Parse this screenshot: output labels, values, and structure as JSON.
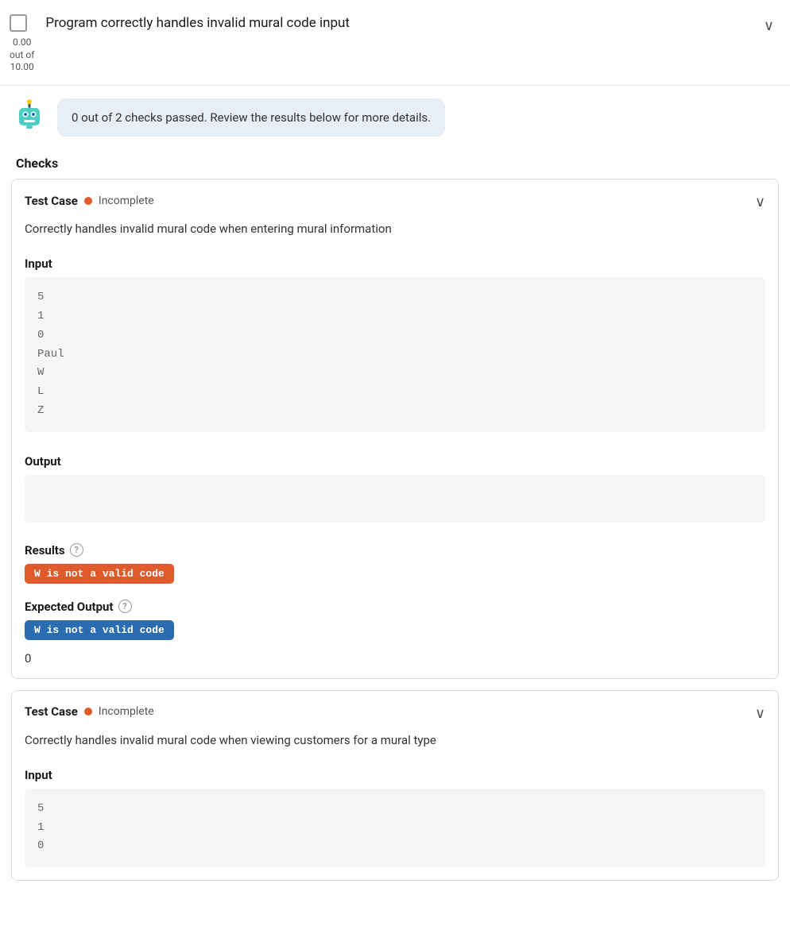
{
  "header": {
    "title": "Program correctly handles invalid mural code input",
    "score": "0.00\nout of\n10.00",
    "score_line1": "0.00",
    "score_line2": "out of",
    "score_line3": "10.00",
    "chevron": "∨"
  },
  "bot_message": "0 out of 2 checks passed. Review the results below for more details.",
  "checks_heading": "Checks",
  "test_cases": [
    {
      "label": "Test Case",
      "status_text": "Incomplete",
      "description": "Correctly handles invalid mural code when entering mural information",
      "input_label": "Input",
      "input_lines": [
        "5",
        "1",
        "0",
        "Paul",
        "W",
        "L",
        "Z"
      ],
      "output_label": "Output",
      "output_value": "",
      "results_label": "Results",
      "result_badge_text": "W is not a valid code",
      "result_badge_type": "red",
      "expected_output_label": "Expected Output",
      "expected_badge_text": "W is not a valid code",
      "expected_badge_type": "blue",
      "zero_label": "0"
    },
    {
      "label": "Test Case",
      "status_text": "Incomplete",
      "description": "Correctly handles invalid mural code when viewing customers for a mural type",
      "input_label": "Input",
      "input_lines": [
        "5",
        "1",
        "0"
      ],
      "output_label": "",
      "output_value": "",
      "results_label": "",
      "result_badge_text": "",
      "result_badge_type": "",
      "expected_output_label": "",
      "expected_badge_text": "",
      "expected_badge_type": "",
      "zero_label": ""
    }
  ]
}
